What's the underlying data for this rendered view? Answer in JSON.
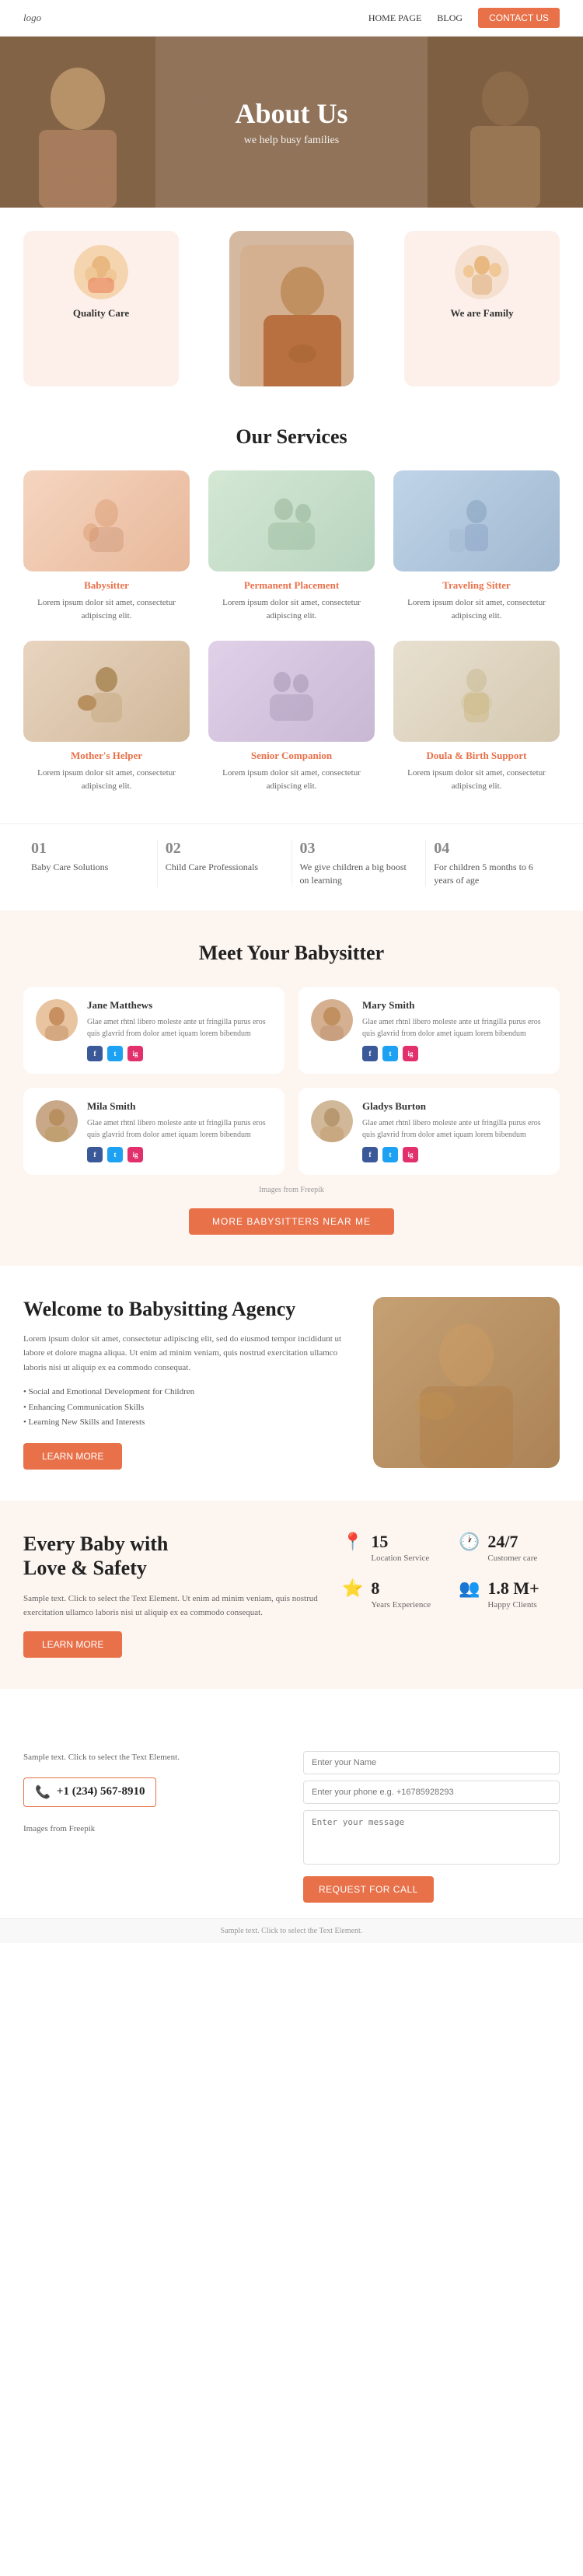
{
  "nav": {
    "logo": "logo",
    "links": [
      {
        "label": "HOME PAGE"
      },
      {
        "label": "BLOG"
      }
    ],
    "cta": "CONTACT US"
  },
  "hero": {
    "title": "About Us",
    "subtitle": "we help busy families"
  },
  "cards": {
    "left": {
      "label": "Quality Care"
    },
    "right": {
      "label": "We are Family"
    }
  },
  "services": {
    "title": "Our Services",
    "items": [
      {
        "name": "Babysitter",
        "desc": "Lorem ipsum dolor sit amet, consectetur adipiscing elit.",
        "color": "c1"
      },
      {
        "name": "Permanent Placement",
        "desc": "Lorem ipsum dolor sit amet, consectetur adipiscing elit.",
        "color": "c2"
      },
      {
        "name": "Traveling Sitter",
        "desc": "Lorem ipsum dolor sit amet, consectetur adipiscing elit.",
        "color": "c3"
      },
      {
        "name": "Mother's Helper",
        "desc": "Lorem ipsum dolor sit amet, consectetur adipiscing elit.",
        "color": "c4"
      },
      {
        "name": "Senior Companion",
        "desc": "Lorem ipsum dolor sit amet, consectetur adipiscing elit.",
        "color": "c5"
      },
      {
        "name": "Doula & Birth Support",
        "desc": "Lorem ipsum dolor sit amet, consectetur adipiscing elit.",
        "color": "c6"
      }
    ]
  },
  "stats_row": [
    {
      "num": "01",
      "label": "Baby Care Solutions"
    },
    {
      "num": "02",
      "label": "Child Care Professionals"
    },
    {
      "num": "03",
      "label": "We give children a big boost on learning"
    },
    {
      "num": "04",
      "label": "For children 5 months to 6 years of age"
    }
  ],
  "meet": {
    "title": "Meet Your Babysitter",
    "babysitters": [
      {
        "name": "Jane Matthews",
        "desc": "Glae amet rhtnl libero moleste ante ut fringilla purus eros quis glavrid from dolor amet iquam lorem bibendum",
        "bg": "#e8c4a0"
      },
      {
        "name": "Mary Smith",
        "desc": "Glae amet rhtnl libero moleste ante ut fringilla purus eros quis glavrid from dolor amet iquam lorem bibendum",
        "bg": "#d4b090"
      },
      {
        "name": "Mila Smith",
        "desc": "Glae amet rhtnl libero moleste ante ut fringilla purus eros quis glavrid from dolor amet iquam lorem bibendum",
        "bg": "#c8a888"
      },
      {
        "name": "Gladys Burton",
        "desc": "Glae amet rhtnl libero moleste ante ut fringilla purus eros quis glavrid from dolor amet iquam lorem bibendum",
        "bg": "#d0b898"
      }
    ],
    "freepik_note": "Images from Freepik",
    "more_btn": "MORE BABYSITTERS NEAR ME"
  },
  "welcome": {
    "title": "Welcome to Babysitting Agency",
    "para": "Lorem ipsum dolor sit amet, consectetur adipiscing elit, sed do eiusmod tempor incididunt ut labore et dolore magna aliqua. Ut enim ad minim veniam, quis nostrud exercitation ullamco laboris nisi ut aliquip ex ea commodo consequat.",
    "list": [
      "Social and Emotional Development for Children",
      "Enhancing Communication Skills",
      "Learning New Skills and Interests"
    ],
    "btn": "LEARN MORE"
  },
  "love": {
    "title_line1": "Every Baby with",
    "title_line2": "Love & Safety",
    "para": "Sample text. Click to select the Text Element. Ut enim ad minim veniam, quis nostrud exercitation ullamco laboris nisi ut aliquip ex ea commodo consequat.",
    "btn": "LEARN MORE",
    "stats": [
      {
        "icon": "📍",
        "value": "15",
        "label": "Location Service"
      },
      {
        "icon": "🕐",
        "value": "24/7",
        "label": "Customer care"
      },
      {
        "icon": "⭐",
        "value": "8",
        "label": "Years Experience"
      },
      {
        "icon": "👥",
        "value": "1.8 M+",
        "label": "Happy Clients"
      }
    ]
  },
  "footer_form": {
    "left_text": "Sample text. Click to select the Text Element.",
    "phone": "+1 (234) 567-8910",
    "fields": {
      "name_placeholder": "Enter your Name",
      "phone_placeholder": "Enter your phone e.g. +16785928293",
      "message_placeholder": "Enter your message"
    },
    "submit_btn": "REQUEST FOR CALL",
    "note": "Images from Freepik"
  },
  "footer_bar": {
    "text": "Sample text. Click to select the Text Element."
  }
}
